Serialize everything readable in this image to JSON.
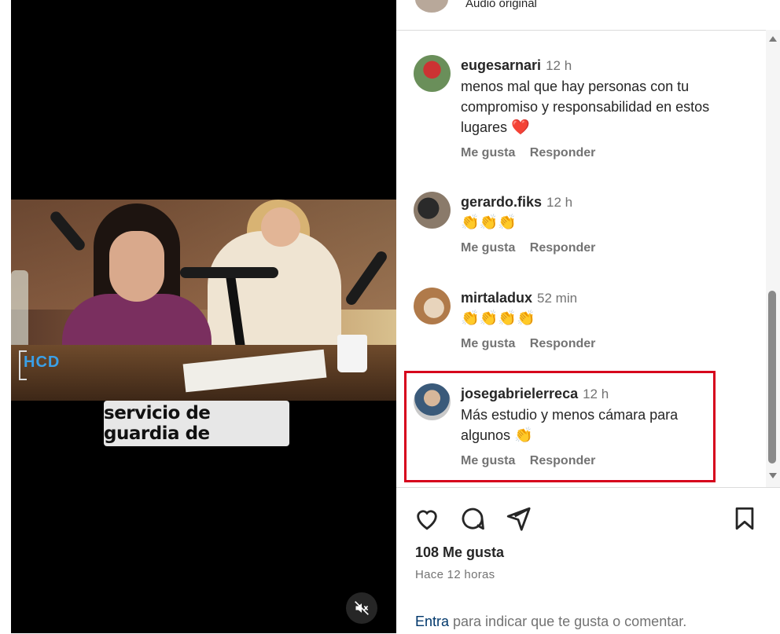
{
  "header": {
    "audio_label": "Audio original"
  },
  "video": {
    "caption": "servicio de guardia de",
    "channel_logo": "HCD",
    "mute_icon": "speaker-muted-icon"
  },
  "comments": [
    {
      "username": "eugesarnari",
      "time": "12 h",
      "lines": [
        "menos mal que hay personas con tu",
        "compromiso y responsabilidad en estos",
        "lugares"
      ],
      "emoji": "❤️",
      "like": "Me gusta",
      "reply": "Responder"
    },
    {
      "username": "gerardo.fiks",
      "time": "12 h",
      "lines": [
        ""
      ],
      "emoji": "👏👏👏",
      "like": "Me gusta",
      "reply": "Responder"
    },
    {
      "username": "mirtaladux",
      "time": "52 min",
      "lines": [
        ""
      ],
      "emoji": "👏👏👏👏",
      "like": "Me gusta",
      "reply": "Responder"
    },
    {
      "username": "josegabrielerreca",
      "time": "12 h",
      "lines": [
        "Más estudio y menos cámara para",
        "algunos"
      ],
      "emoji": "👏",
      "like": "Me gusta",
      "reply": "Responder"
    }
  ],
  "footer": {
    "likes": "108 Me gusta",
    "ago": "Hace 12 horas",
    "login_link": "Entra",
    "login_rest": " para indicar que te gusta o comentar."
  },
  "colors": {
    "highlight_border": "#d6001c",
    "link": "#00376b",
    "muted_text": "#737373"
  }
}
